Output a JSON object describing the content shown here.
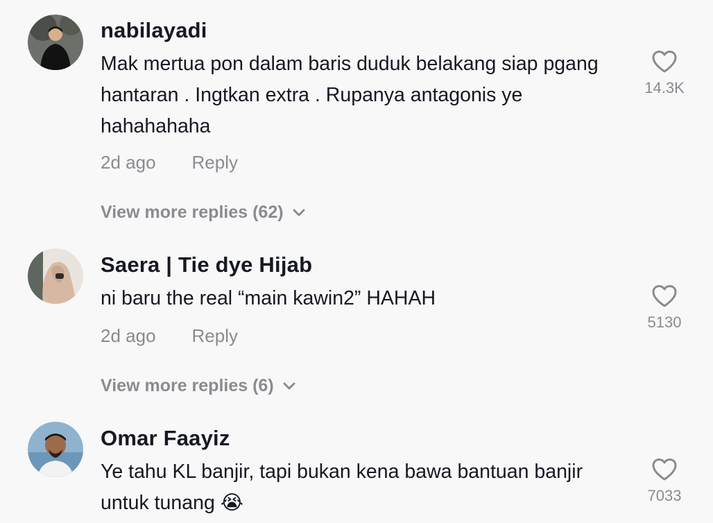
{
  "comments": [
    {
      "username": "nabilayadi",
      "text": "Mak mertua pon dalam baris duduk belakang siap pgang hantaran . Ingtkan extra . Rupanya antagonis ye hahahahaha",
      "time": "2d ago",
      "reply_label": "Reply",
      "likes": "14.3K",
      "more_replies": "View more replies (62)",
      "icons": {
        "like": "heart-icon",
        "expand": "chevron-down-icon"
      }
    },
    {
      "username": "Saera | Tie dye Hijab",
      "text": "ni baru the real “main kawin2” HAHAH",
      "time": "2d ago",
      "reply_label": "Reply",
      "likes": "5130",
      "more_replies": "View more replies (6)",
      "icons": {
        "like": "heart-icon",
        "expand": "chevron-down-icon"
      }
    },
    {
      "username": "Omar Faayiz",
      "text": "Ye tahu KL banjir, tapi bukan kena bawa bantuan banjir untuk tunang 😭",
      "likes": "7033",
      "icons": {
        "like": "heart-icon"
      }
    }
  ],
  "colors": {
    "background": "#f8f8f8",
    "primary_text": "#161823",
    "secondary_text": "#8a8b91"
  }
}
